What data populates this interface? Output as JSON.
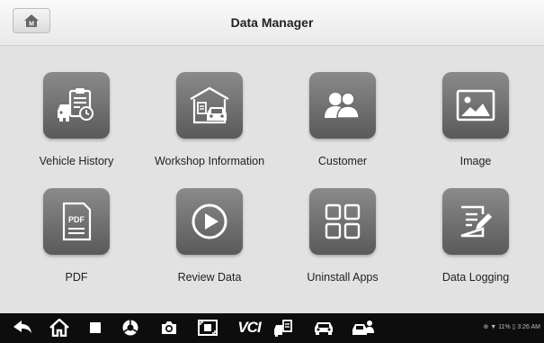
{
  "header": {
    "title": "Data Manager",
    "home_icon_letter": "M"
  },
  "tiles": [
    {
      "label": "Vehicle History",
      "icon": "vehicle-history-icon"
    },
    {
      "label": "Workshop Information",
      "icon": "workshop-icon"
    },
    {
      "label": "Customer",
      "icon": "customer-icon"
    },
    {
      "label": "Image",
      "icon": "image-icon"
    },
    {
      "label": "PDF",
      "icon": "pdf-icon"
    },
    {
      "label": "Review Data",
      "icon": "play-icon"
    },
    {
      "label": "Uninstall Apps",
      "icon": "apps-grid-icon"
    },
    {
      "label": "Data Logging",
      "icon": "data-logging-icon"
    }
  ],
  "pdf_icon_text": "PDF",
  "system_bar": {
    "vci_label": "VCI",
    "status_text": "⊕ ▼ 11% ▯ 3:26 AM"
  },
  "colors": {
    "background": "#e2e2e2",
    "tile_gradient_top": "#8a8a8a",
    "tile_gradient_bottom": "#5a5a5a",
    "system_bar": "#0d0d0d"
  }
}
